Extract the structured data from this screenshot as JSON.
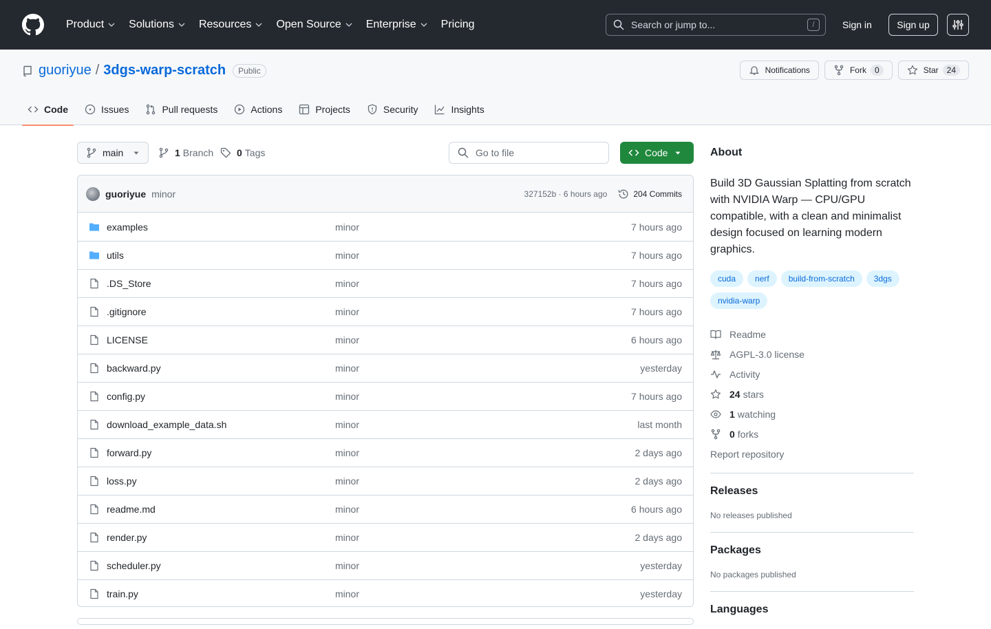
{
  "header": {
    "nav": [
      "Product",
      "Solutions",
      "Resources",
      "Open Source",
      "Enterprise",
      "Pricing"
    ],
    "search_placeholder": "Search or jump to...",
    "slash": "/",
    "sign_in": "Sign in",
    "sign_up": "Sign up"
  },
  "repo": {
    "owner": "guoriyue",
    "separator": "/",
    "name": "3dgs-warp-scratch",
    "visibility": "Public",
    "notifications_label": "Notifications",
    "fork_label": "Fork",
    "fork_count": "0",
    "star_label": "Star",
    "star_count": "24",
    "tabs": [
      "Code",
      "Issues",
      "Pull requests",
      "Actions",
      "Projects",
      "Security",
      "Insights"
    ]
  },
  "toolbar": {
    "branch": "main",
    "branch_count": "1",
    "branch_label": "Branch",
    "tag_count": "0",
    "tag_label": "Tags",
    "go_to_file": "Go to file",
    "code_label": "Code"
  },
  "commit": {
    "user": "guoriyue",
    "message": "minor",
    "meta": "327152b · 6 hours ago",
    "count": "204 Commits"
  },
  "files": [
    {
      "name": "examples",
      "type": "dir",
      "message": "minor",
      "date": "7 hours ago"
    },
    {
      "name": "utils",
      "type": "dir",
      "message": "minor",
      "date": "7 hours ago"
    },
    {
      "name": ".DS_Store",
      "type": "file",
      "message": "minor",
      "date": "7 hours ago"
    },
    {
      "name": ".gitignore",
      "type": "file",
      "message": "minor",
      "date": "7 hours ago"
    },
    {
      "name": "LICENSE",
      "type": "file",
      "message": "minor",
      "date": "6 hours ago"
    },
    {
      "name": "backward.py",
      "type": "file",
      "message": "minor",
      "date": "yesterday"
    },
    {
      "name": "config.py",
      "type": "file",
      "message": "minor",
      "date": "7 hours ago"
    },
    {
      "name": "download_example_data.sh",
      "type": "file",
      "message": "minor",
      "date": "last month"
    },
    {
      "name": "forward.py",
      "type": "file",
      "message": "minor",
      "date": "2 days ago"
    },
    {
      "name": "loss.py",
      "type": "file",
      "message": "minor",
      "date": "2 days ago"
    },
    {
      "name": "readme.md",
      "type": "file",
      "message": "minor",
      "date": "6 hours ago"
    },
    {
      "name": "render.py",
      "type": "file",
      "message": "minor",
      "date": "2 days ago"
    },
    {
      "name": "scheduler.py",
      "type": "file",
      "message": "minor",
      "date": "yesterday"
    },
    {
      "name": "train.py",
      "type": "file",
      "message": "minor",
      "date": "yesterday"
    }
  ],
  "about": {
    "heading": "About",
    "description": "Build 3D Gaussian Splatting from scratch with NVIDIA Warp — CPU/GPU compatible, with a clean and minimalist design focused on learning modern graphics.",
    "topics": [
      "cuda",
      "nerf",
      "build-from-scratch",
      "3dgs",
      "nvidia-warp"
    ],
    "readme": "Readme",
    "license": "AGPL-3.0 license",
    "activity": "Activity",
    "stars_count": "24",
    "stars_label": "stars",
    "watching_count": "1",
    "watching_label": "watching",
    "forks_count": "0",
    "forks_label": "forks",
    "report": "Report repository"
  },
  "releases": {
    "heading": "Releases",
    "text": "No releases published"
  },
  "packages": {
    "heading": "Packages",
    "text": "No packages published"
  },
  "languages": {
    "heading": "Languages"
  },
  "colors": {
    "header_bg": "#24292f",
    "link": "#0969da",
    "code_button": "#1f883d",
    "folder": "#54aeff",
    "topic_bg": "#ddf4ff",
    "active_tab": "#fd8c73"
  }
}
